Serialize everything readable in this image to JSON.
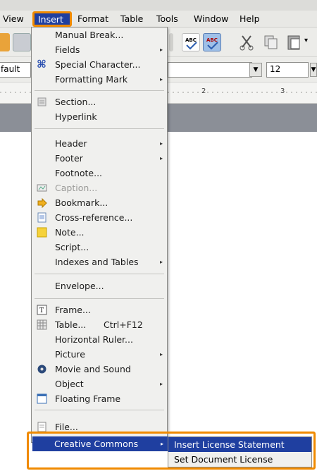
{
  "menubar": {
    "items": [
      {
        "label": "View",
        "key": "view"
      },
      {
        "label": "Insert",
        "key": "insert"
      },
      {
        "label": "Format",
        "key": "format"
      },
      {
        "label": "Table",
        "key": "table"
      },
      {
        "label": "Tools",
        "key": "tools"
      },
      {
        "label": "Window",
        "key": "window"
      },
      {
        "label": "Help",
        "key": "help"
      }
    ]
  },
  "toolbar": {
    "style_value": "fault",
    "font_size_value": "12"
  },
  "ruler": {
    "mark2": "2",
    "mark3": "3"
  },
  "insert_menu": {
    "items": [
      {
        "label": "Manual Break...",
        "submenu": false
      },
      {
        "label": "Fields",
        "submenu": true
      },
      {
        "label": "Special Character...",
        "submenu": false,
        "icon": "special-character-icon"
      },
      {
        "label": "Formatting Mark",
        "submenu": true
      },
      {
        "label": "Section...",
        "submenu": false,
        "icon": "section-icon"
      },
      {
        "label": "Hyperlink",
        "submenu": false
      },
      {
        "label": "Header",
        "submenu": true
      },
      {
        "label": "Footer",
        "submenu": true
      },
      {
        "label": "Footnote...",
        "submenu": false
      },
      {
        "label": "Caption...",
        "submenu": false,
        "disabled": true,
        "icon": "caption-icon"
      },
      {
        "label": "Bookmark...",
        "submenu": false,
        "icon": "bookmark-icon"
      },
      {
        "label": "Cross-reference...",
        "submenu": false,
        "icon": "cross-reference-icon"
      },
      {
        "label": "Note...",
        "submenu": false,
        "icon": "note-icon"
      },
      {
        "label": "Script...",
        "submenu": false
      },
      {
        "label": "Indexes and Tables",
        "submenu": true
      },
      {
        "label": "Envelope...",
        "submenu": false
      },
      {
        "label": "Frame...",
        "submenu": false,
        "icon": "frame-icon"
      },
      {
        "label": "Table...",
        "shortcut": "Ctrl+F12",
        "submenu": false,
        "icon": "table-icon"
      },
      {
        "label": "Horizontal Ruler...",
        "submenu": false
      },
      {
        "label": "Picture",
        "submenu": true
      },
      {
        "label": "Movie and Sound",
        "submenu": false,
        "icon": "movie-sound-icon"
      },
      {
        "label": "Object",
        "submenu": true
      },
      {
        "label": "Floating Frame",
        "submenu": false,
        "icon": "floating-frame-icon"
      },
      {
        "label": "File...",
        "submenu": false,
        "icon": "file-icon"
      },
      {
        "label": "Creative Commons",
        "submenu": true,
        "highlighted": true
      }
    ]
  },
  "creative_commons_submenu": {
    "items": [
      {
        "label": "Insert License Statement",
        "active": true
      },
      {
        "label": "Set Document License",
        "active": false
      }
    ]
  },
  "colors": {
    "highlight": "#1f3fa0",
    "annotation_orange": "#f08a00",
    "menu_bg": "#f0f0ee"
  }
}
